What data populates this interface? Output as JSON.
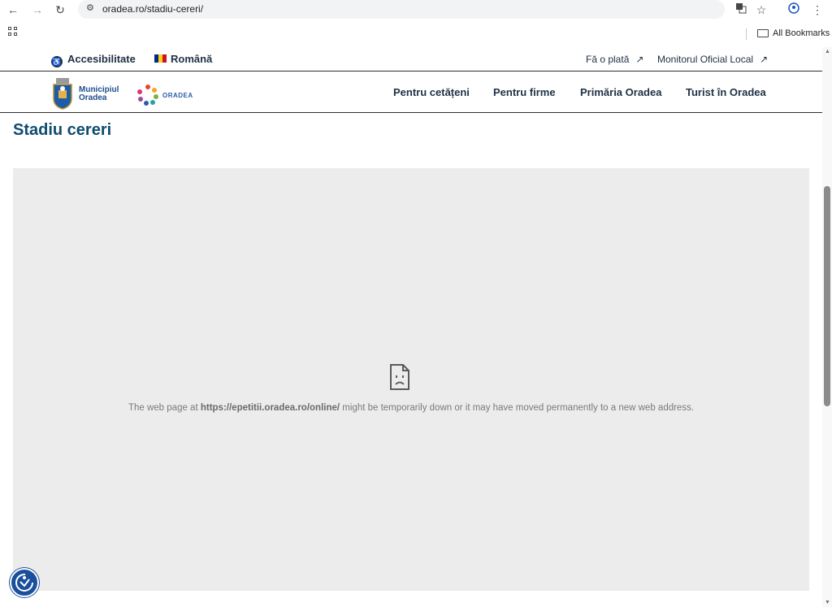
{
  "browser": {
    "url": "oradea.ro/stadiu-cereri/",
    "bookmarks_label": "All Bookmarks",
    "icons": [
      "back-icon",
      "forward-icon",
      "reload-icon",
      "site-settings-icon",
      "translate-icon",
      "star-icon",
      "profile-icon",
      "menu-icon",
      "apps-icon",
      "folder-icon"
    ]
  },
  "utility": {
    "accessibility": "Accesibilitate",
    "language": "Română",
    "pay": "Fă o plată",
    "monitor": "Monitorul Oficial Local"
  },
  "header": {
    "logo_line1": "Municipiul",
    "logo_line2": "Oradea",
    "brand": "ORADEA"
  },
  "nav": {
    "items": [
      "Pentru cetățeni",
      "Pentru firme",
      "Primăria Oradea",
      "Turist în Oradea"
    ]
  },
  "page": {
    "title": "Stadiu cereri"
  },
  "error": {
    "prefix": "The web page at ",
    "url": "https://epetitii.oradea.ro/online/",
    "suffix": " might be temporarily down or it may have moved permanently to a new web address."
  },
  "colors": {
    "brand_navy": "#1f3044",
    "title_teal": "#0f4c6e",
    "frame_bg": "#ececec",
    "widget_blue": "#1b4f9c"
  }
}
